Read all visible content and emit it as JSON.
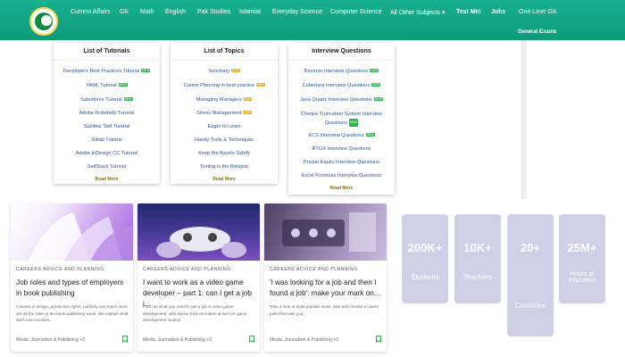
{
  "nav": {
    "items": [
      "Current Affairs",
      "GK",
      "Math",
      "English",
      "Pak Studies",
      "Islamiat",
      "Everyday Science",
      "Computer Science",
      "All Other Subjects",
      "Test Me!",
      "Jobs",
      "One Liner GK"
    ],
    "dropdown_caret": "▾",
    "second_row": "General Exams"
  },
  "mega_menu": {
    "tutorials": {
      "heading": "List of Tutorials",
      "items": [
        "Developers Best Practices Tutorial",
        "YAML Tutorial",
        "Salesforce Tutorial",
        "Adobe Robohelp Tutorial",
        "Sublime Text Tutorial",
        "Gitlab Tutorial",
        "Adobe InDesign CC Tutorial",
        "SaltStack Tutorial"
      ],
      "badges": [
        "new",
        "new",
        "new",
        "",
        "",
        "",
        "",
        ""
      ],
      "read_more": "Read More"
    },
    "topics": {
      "heading": "List of Topics",
      "items": [
        "Summary",
        "Career Planning in best practice",
        "Managing Managers",
        "Stress Management",
        "Eager to Learn",
        "Handy Tools & Techniques",
        "Keep the Assets Safely",
        "Testing is the Religion"
      ],
      "badges": [
        "hot",
        "hot",
        "hot",
        "hot",
        "",
        "",
        "",
        ""
      ],
      "read_more": "Read More"
    },
    "interview": {
      "heading": "Interview Questions",
      "items": [
        "Reverse Interview Questions",
        "Cobertura Interview Questions",
        "Java Quartz Interview Questions",
        "Cheque Truncation System Interview Questions",
        "ECS Interview Questions",
        "RTGS Interview Questions",
        "Private Equity Interview Questions",
        "Excel Formulas Interview Questions"
      ],
      "badges": [
        "new",
        "new",
        "new",
        "new",
        "new",
        "",
        "",
        ""
      ],
      "read_more": "Read More"
    },
    "badge_labels": {
      "new": "NEW",
      "hot": "HOT"
    }
  },
  "cards": [
    {
      "category": "CAREERS ADVICE AND PLANNING",
      "title": "Job roles and types of employers in book publishing",
      "description": "Careers in design, production rights, publicity and much more are all the roles in the book publishing world. We explain what each role involves...",
      "footer": "Media, Journalism & Publishing +3"
    },
    {
      "category": "CAREERS ADVICE AND PLANNING",
      "title": "I want to work as a video game developer – part 1: can I get a job i...",
      "description": "Find out what you need to get a job in video game development, with advice from recruiters at two UK game development studios.",
      "footer": "Media, Journalism & Publishing +3"
    },
    {
      "category": "CAREERS ADVICE AND PLANNING",
      "title": "'I was looking for a job and then I found a job': make your mark on...",
      "description": "Take a look at eight popular music jobs and choose a career path that suits you.",
      "footer": "Media, Journalism & Publishing +3"
    }
  ],
  "stats": [
    {
      "value": "200K+",
      "label": "Students"
    },
    {
      "value": "10K+",
      "label": "Teachers"
    },
    {
      "value": "20+",
      "label": "Countries"
    },
    {
      "value": "25M+",
      "label": "Hours of education"
    }
  ],
  "colors": {
    "nav_bg": "#12a485",
    "link": "#2a5599",
    "stat_bg": "#cfcfe6",
    "badge_new": "#2db34a",
    "badge_hot": "#e6b12a"
  }
}
